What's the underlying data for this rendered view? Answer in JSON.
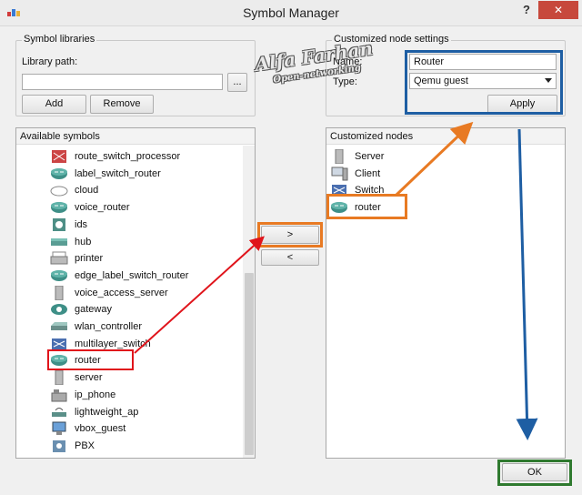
{
  "window": {
    "title": "Symbol Manager",
    "help_label": "?",
    "close_label": "✕"
  },
  "libraries": {
    "group_title": "Symbol libraries",
    "path_label": "Library path:",
    "path_value": "",
    "browse_label": "...",
    "add_label": "Add",
    "remove_label": "Remove"
  },
  "available": {
    "header": "Available symbols",
    "items": [
      {
        "label": "route_switch_processor",
        "icon": "rsp-icon"
      },
      {
        "label": "label_switch_router",
        "icon": "router-icon"
      },
      {
        "label": "cloud",
        "icon": "cloud-icon"
      },
      {
        "label": "voice_router",
        "icon": "router-icon"
      },
      {
        "label": "ids",
        "icon": "ids-icon"
      },
      {
        "label": "hub",
        "icon": "hub-icon"
      },
      {
        "label": "printer",
        "icon": "printer-icon"
      },
      {
        "label": "edge_label_switch_router",
        "icon": "router-icon"
      },
      {
        "label": "voice_access_server",
        "icon": "server-icon"
      },
      {
        "label": "gateway",
        "icon": "gateway-icon"
      },
      {
        "label": "wlan_controller",
        "icon": "controller-icon"
      },
      {
        "label": "multilayer_switch",
        "icon": "switch-icon"
      },
      {
        "label": "router",
        "icon": "router-icon"
      },
      {
        "label": "server",
        "icon": "server-icon"
      },
      {
        "label": "ip_phone",
        "icon": "phone-icon"
      },
      {
        "label": "lightweight_ap",
        "icon": "ap-icon"
      },
      {
        "label": "vbox_guest",
        "icon": "vbox-icon"
      },
      {
        "label": "PBX",
        "icon": "pbx-icon"
      }
    ]
  },
  "transfer": {
    "add_label": ">",
    "remove_label": "<"
  },
  "customized": {
    "group_title": "Customized node settings",
    "name_label": "Name:",
    "name_value": "Router",
    "type_label": "Type:",
    "type_value": "Qemu guest",
    "apply_label": "Apply",
    "header": "Customized nodes",
    "items": [
      {
        "label": "Server",
        "icon": "server-icon"
      },
      {
        "label": "Client",
        "icon": "client-icon"
      },
      {
        "label": "Switch",
        "icon": "switch-icon"
      },
      {
        "label": "router",
        "icon": "router-icon"
      }
    ]
  },
  "ok_label": "OK",
  "watermark": {
    "line1": "Alfa Farhan",
    "line2": "Open-networking"
  },
  "colors": {
    "orange": "#e87a23",
    "red": "#e0141b",
    "blue": "#1e5ea3",
    "green": "#2f7a2f",
    "router": "#3e8f87"
  }
}
